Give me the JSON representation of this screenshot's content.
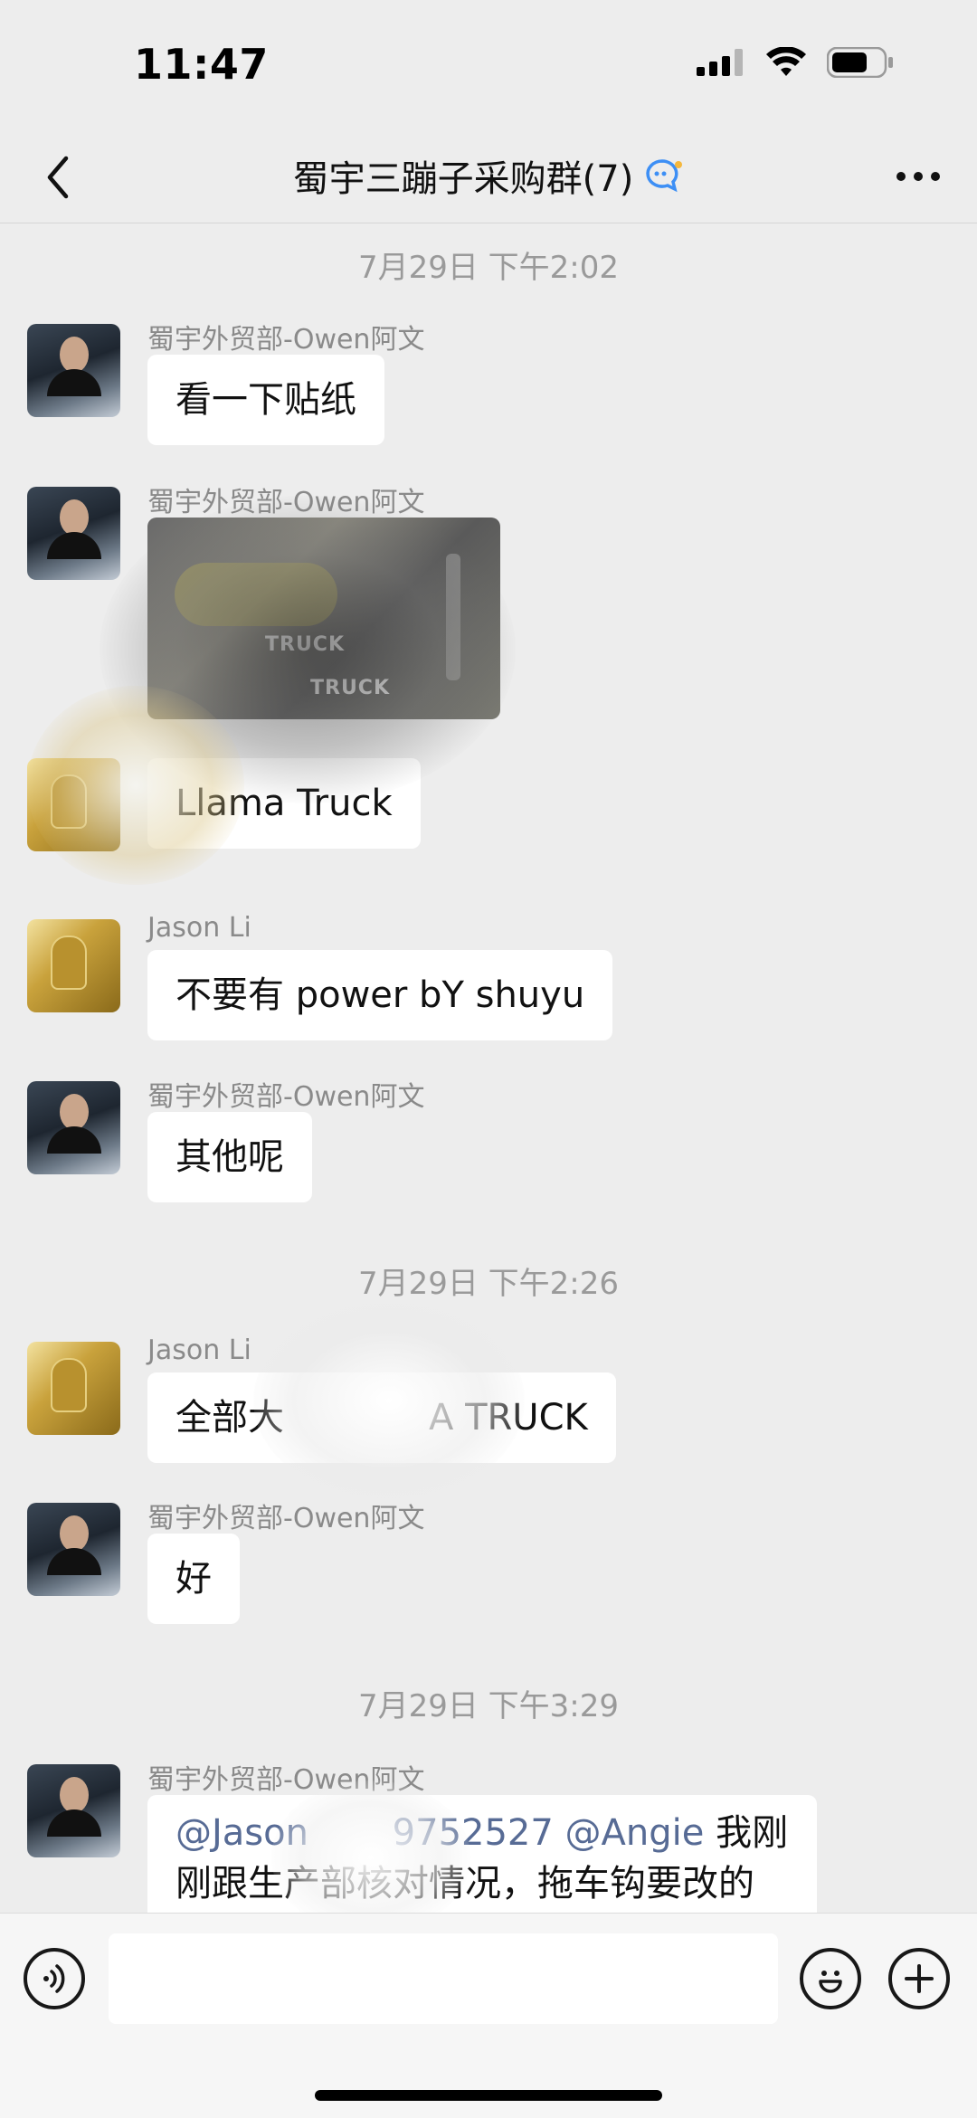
{
  "status_bar": {
    "time": "11:47"
  },
  "nav": {
    "title": "蜀宇三蹦子采购群(7)"
  },
  "messages": [
    {
      "type": "time",
      "text": "7月29日 下午2:02"
    },
    {
      "type": "text",
      "sender": "蜀宇外贸部-Owen阿文",
      "text": "看一下贴纸"
    },
    {
      "type": "image",
      "sender": "蜀宇外贸部-Owen阿文",
      "image_text": [
        "TRUCK",
        "TRUCK"
      ]
    },
    {
      "type": "text",
      "sender": "",
      "text": "Llama Truck"
    },
    {
      "type": "text",
      "sender": "Jason Li",
      "text": "不要有 power bY shuyu"
    },
    {
      "type": "text",
      "sender": "蜀宇外贸部-Owen阿文",
      "text": "其他呢"
    },
    {
      "type": "time",
      "text": "7月29日 下午2:26"
    },
    {
      "type": "text",
      "sender": "Jason Li",
      "text": "全部大　　　　A TRUCK"
    },
    {
      "type": "text",
      "sender": "蜀宇外贸部-Owen阿文",
      "text": "好"
    },
    {
      "type": "time",
      "text": "7月29日 下午3:29"
    },
    {
      "type": "text",
      "sender": "蜀宇外贸部-Owen阿文",
      "mention": "@Jason  　　9752527 @Angie",
      "text": " 我刚刚跟生产部核对情况，拖车钩要改的"
    }
  ],
  "input": {
    "placeholder": ""
  },
  "icons": {
    "back": "chevron-left-icon",
    "chat_group": "group-chat-icon",
    "more": "more-dots-icon",
    "voice": "voice-icon",
    "emoji": "emoji-icon",
    "add": "plus-icon"
  },
  "colors": {
    "background": "#ededed",
    "bubble": "#ffffff",
    "mention": "#576b95",
    "timestamp": "#9a9a9a"
  }
}
